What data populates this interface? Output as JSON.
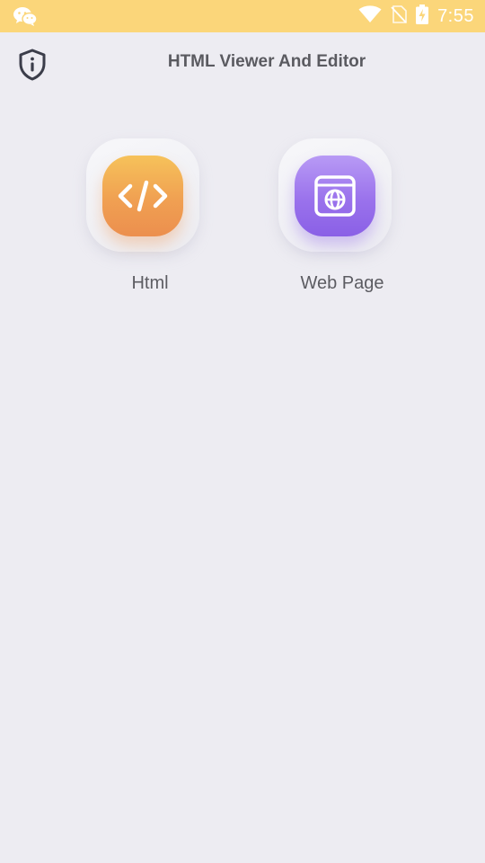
{
  "status_bar": {
    "time": "7:55",
    "background": "#fbd67a",
    "icons": [
      "wechat-icon",
      "wifi-icon",
      "no-sim-icon",
      "battery-charging-icon"
    ]
  },
  "app_bar": {
    "title": "HTML Viewer And Editor",
    "info_icon": "shield-info-icon"
  },
  "tiles": [
    {
      "label": "Html",
      "icon": "code-brackets-icon",
      "accent": "#f0a052"
    },
    {
      "label": "Web Page",
      "icon": "web-page-globe-icon",
      "accent": "#9a72ec"
    }
  ],
  "colors": {
    "background": "#edecf2",
    "title_text": "#5a5a60"
  }
}
